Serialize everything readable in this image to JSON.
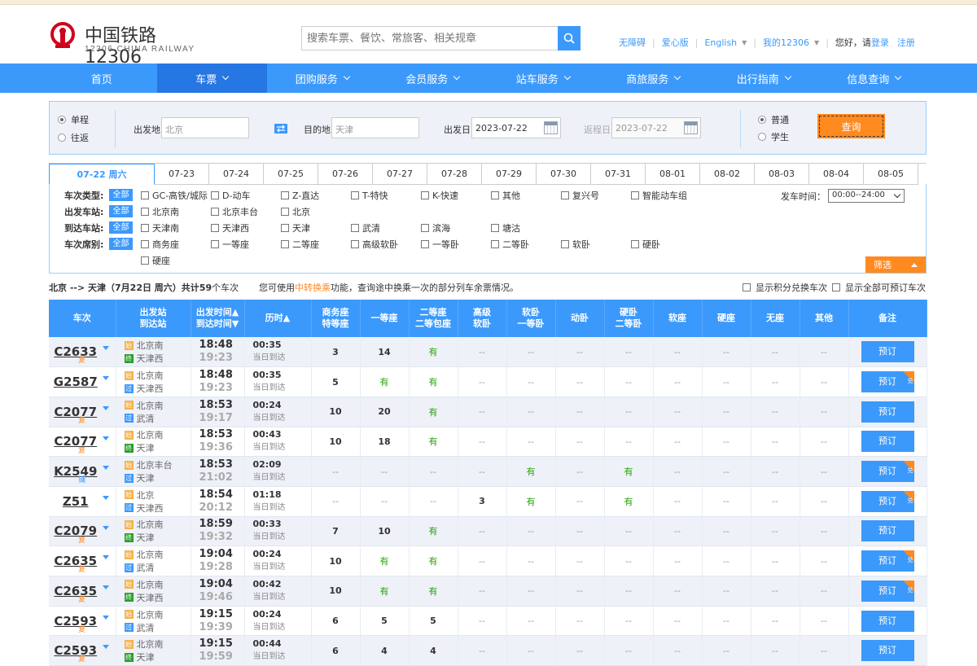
{
  "header": {
    "logo_cn": "中国铁路12306",
    "logo_en": "12306 CHINA RAILWAY",
    "search_placeholder": "搜索车票、餐饮、常旅客、相关规章",
    "links": [
      "无障碍",
      "爱心版",
      "English",
      "我的12306"
    ],
    "greeting": "您好，请",
    "login": "登录",
    "register": "注册"
  },
  "nav": [
    {
      "label": "首页",
      "dropdown": false,
      "active": false
    },
    {
      "label": "车票",
      "dropdown": true,
      "active": true
    },
    {
      "label": "团购服务",
      "dropdown": true,
      "active": false
    },
    {
      "label": "会员服务",
      "dropdown": true,
      "active": false
    },
    {
      "label": "站车服务",
      "dropdown": true,
      "active": false
    },
    {
      "label": "商旅服务",
      "dropdown": true,
      "active": false
    },
    {
      "label": "出行指南",
      "dropdown": true,
      "active": false
    },
    {
      "label": "信息查询",
      "dropdown": true,
      "active": false
    }
  ],
  "query": {
    "trip_one_way": "单程",
    "trip_round": "往返",
    "from_label": "出发地",
    "from_value": "北京",
    "to_label": "目的地",
    "to_value": "天津",
    "depart_label": "出发日",
    "depart_value": "2023-07-22",
    "return_label": "返程日",
    "return_value": "2023-07-22",
    "ticket_normal": "普通",
    "ticket_student": "学生",
    "search_button": "查询"
  },
  "dates": [
    "07-22 周六",
    "07-23",
    "07-24",
    "07-25",
    "07-26",
    "07-27",
    "07-28",
    "07-29",
    "07-30",
    "07-31",
    "08-01",
    "08-02",
    "08-03",
    "08-04",
    "08-05"
  ],
  "filters": {
    "all": "全部",
    "type_label": "车次类型:",
    "types": [
      "GC-高铁/城际",
      "D-动车",
      "Z-直达",
      "T-特快",
      "K-快速",
      "其他",
      "复兴号",
      "智能动车组"
    ],
    "from_label": "出发车站:",
    "from_stations": [
      "北京南",
      "北京丰台",
      "北京"
    ],
    "to_label": "到达车站:",
    "to_stations": [
      "天津南",
      "天津西",
      "天津",
      "武清",
      "滨海",
      "塘沽"
    ],
    "seat_label": "车次席别:",
    "seats": [
      "商务座",
      "一等座",
      "二等座",
      "高级软卧",
      "一等卧",
      "二等卧",
      "软卧",
      "硬卧",
      "硬座"
    ],
    "time_label": "发车时间：",
    "time_value": "00:00--24:00",
    "filter_button": "筛选"
  },
  "summary": {
    "route": "北京 --> 天津（7月22日  周六）共计",
    "count": "59",
    "count_suffix": "个车次",
    "hint_pre": "您可使用",
    "hint_link": "中转换乘",
    "hint_post": "功能，查询途中换乘一次的部分列车余票情况。",
    "opt1": "显示积分兑换车次",
    "opt2": "显示全部可预订车次"
  },
  "table_headers": [
    "车次",
    "出发站\n到达站",
    "出发时间▲\n到达时间▼",
    "历时▲",
    "商务座\n特等座",
    "一等座",
    "二等座\n二等包座",
    "高级\n软卧",
    "软卧\n一等卧",
    "动卧",
    "硬卧\n二等卧",
    "软座",
    "硬座",
    "无座",
    "其他",
    "备注"
  ],
  "rows": [
    {
      "code": "C2633",
      "sub": "复",
      "sub_color": "orange",
      "from": "北京南",
      "from_tag": "始",
      "to": "天津西",
      "to_tag": "终",
      "dep": "18:48",
      "arr": "19:23",
      "dur": "00:35",
      "day": "当日到达",
      "seats": [
        "3",
        "14",
        "有",
        "--",
        "--",
        "--",
        "--",
        "--",
        "--",
        "--",
        "--"
      ],
      "book": "预订",
      "badge": false
    },
    {
      "code": "G2587",
      "sub": "",
      "sub_color": "orange",
      "from": "北京南",
      "from_tag": "始",
      "to": "天津西",
      "to_tag": "过",
      "dep": "18:48",
      "arr": "19:23",
      "dur": "00:35",
      "day": "当日到达",
      "seats": [
        "5",
        "有",
        "有",
        "--",
        "--",
        "--",
        "--",
        "--",
        "--",
        "--",
        "--"
      ],
      "book": "预订",
      "badge": true
    },
    {
      "code": "C2077",
      "sub": "复",
      "sub_color": "orange",
      "from": "北京南",
      "from_tag": "始",
      "to": "武清",
      "to_tag": "过",
      "dep": "18:53",
      "arr": "19:17",
      "dur": "00:24",
      "day": "当日到达",
      "seats": [
        "10",
        "20",
        "有",
        "--",
        "--",
        "--",
        "--",
        "--",
        "--",
        "--",
        "--"
      ],
      "book": "预订",
      "badge": false
    },
    {
      "code": "C2077",
      "sub": "复",
      "sub_color": "orange",
      "from": "北京南",
      "from_tag": "始",
      "to": "天津",
      "to_tag": "终",
      "dep": "18:53",
      "arr": "19:36",
      "dur": "00:43",
      "day": "当日到达",
      "seats": [
        "10",
        "18",
        "有",
        "--",
        "--",
        "--",
        "--",
        "--",
        "--",
        "--",
        "--"
      ],
      "book": "预订",
      "badge": false
    },
    {
      "code": "K2549",
      "sub": "铺",
      "sub_color": "blue",
      "from": "北京丰台",
      "from_tag": "始",
      "to": "天津",
      "to_tag": "过",
      "dep": "18:53",
      "arr": "21:02",
      "dur": "02:09",
      "day": "当日到达",
      "seats": [
        "--",
        "--",
        "--",
        "--",
        "有",
        "--",
        "有",
        "--",
        "--",
        "--",
        "--"
      ],
      "book": "预订",
      "badge": true
    },
    {
      "code": "Z51",
      "sub": "",
      "sub_color": "orange",
      "from": "北京",
      "from_tag": "始",
      "to": "天津西",
      "to_tag": "过",
      "dep": "18:54",
      "arr": "20:12",
      "dur": "01:18",
      "day": "当日到达",
      "seats": [
        "--",
        "--",
        "--",
        "3",
        "有",
        "--",
        "有",
        "--",
        "--",
        "--",
        "--"
      ],
      "book": "预订",
      "badge": true
    },
    {
      "code": "C2079",
      "sub": "复",
      "sub_color": "orange",
      "from": "北京南",
      "from_tag": "始",
      "to": "天津",
      "to_tag": "终",
      "dep": "18:59",
      "arr": "19:32",
      "dur": "00:33",
      "day": "当日到达",
      "seats": [
        "7",
        "10",
        "有",
        "--",
        "--",
        "--",
        "--",
        "--",
        "--",
        "--",
        "--"
      ],
      "book": "预订",
      "badge": false
    },
    {
      "code": "C2635",
      "sub": "复",
      "sub_color": "orange",
      "from": "北京南",
      "from_tag": "始",
      "to": "武清",
      "to_tag": "过",
      "dep": "19:04",
      "arr": "19:28",
      "dur": "00:24",
      "day": "当日到达",
      "seats": [
        "10",
        "有",
        "有",
        "--",
        "--",
        "--",
        "--",
        "--",
        "--",
        "--",
        "--"
      ],
      "book": "预订",
      "badge": true
    },
    {
      "code": "C2635",
      "sub": "复",
      "sub_color": "orange",
      "from": "北京南",
      "from_tag": "始",
      "to": "天津西",
      "to_tag": "终",
      "dep": "19:04",
      "arr": "19:46",
      "dur": "00:42",
      "day": "当日到达",
      "seats": [
        "10",
        "有",
        "有",
        "--",
        "--",
        "--",
        "--",
        "--",
        "--",
        "--",
        "--"
      ],
      "book": "预订",
      "badge": true
    },
    {
      "code": "C2593",
      "sub": "复",
      "sub_color": "orange",
      "from": "北京南",
      "from_tag": "始",
      "to": "武清",
      "to_tag": "过",
      "dep": "19:15",
      "arr": "19:39",
      "dur": "00:24",
      "day": "当日到达",
      "seats": [
        "6",
        "5",
        "5",
        "--",
        "--",
        "--",
        "--",
        "--",
        "--",
        "--",
        "--"
      ],
      "book": "预订",
      "badge": false
    },
    {
      "code": "C2593",
      "sub": "复",
      "sub_color": "orange",
      "from": "北京南",
      "from_tag": "始",
      "to": "天津",
      "to_tag": "终",
      "dep": "19:15",
      "arr": "19:59",
      "dur": "00:44",
      "day": "当日到达",
      "seats": [
        "6",
        "4",
        "4",
        "--",
        "--",
        "--",
        "--",
        "--",
        "--",
        "--",
        "--"
      ],
      "book": "预订",
      "badge": false
    }
  ],
  "colors": {
    "brand_blue": "#3b99fc",
    "active_blue": "#2676e3",
    "orange": "#ff8a1f",
    "green": "#26a306",
    "logo_red": "#d0021b"
  }
}
